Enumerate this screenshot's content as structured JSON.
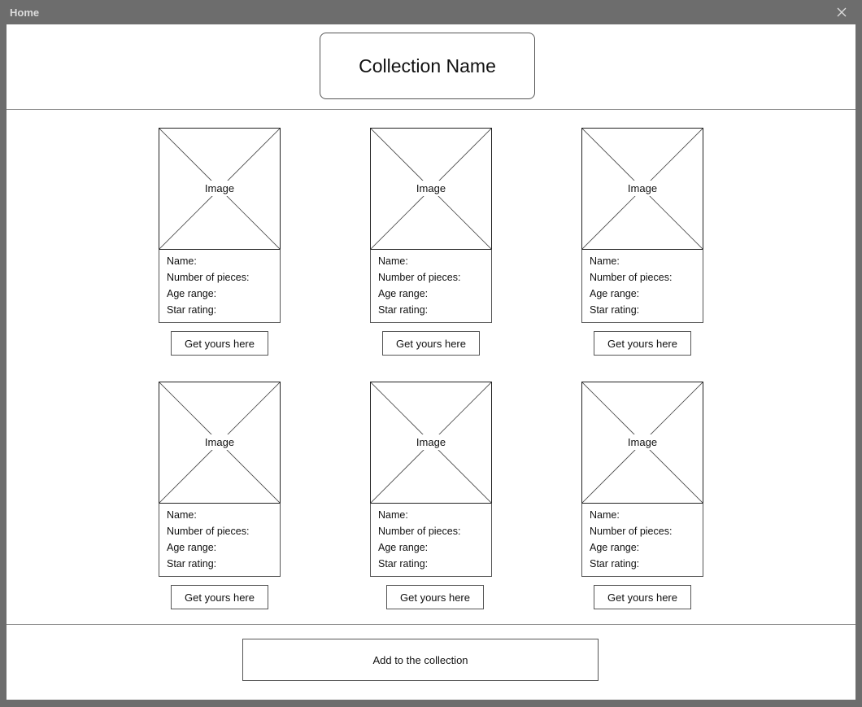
{
  "window": {
    "title": "Home"
  },
  "header": {
    "collection_name": "Collection Name"
  },
  "cards": [
    {
      "image_label": "Image",
      "name_label": "Name:",
      "pieces_label": "Number of pieces:",
      "age_label": "Age range:",
      "rating_label": "Star rating:",
      "button_label": "Get yours here"
    },
    {
      "image_label": "Image",
      "name_label": "Name:",
      "pieces_label": "Number of pieces:",
      "age_label": "Age range:",
      "rating_label": "Star rating:",
      "button_label": "Get yours here"
    },
    {
      "image_label": "Image",
      "name_label": "Name:",
      "pieces_label": "Number of pieces:",
      "age_label": "Age range:",
      "rating_label": "Star rating:",
      "button_label": "Get yours here"
    },
    {
      "image_label": "Image",
      "name_label": "Name:",
      "pieces_label": "Number of pieces:",
      "age_label": "Age range:",
      "rating_label": "Star rating:",
      "button_label": "Get yours here"
    },
    {
      "image_label": "Image",
      "name_label": "Name:",
      "pieces_label": "Number of pieces:",
      "age_label": "Age range:",
      "rating_label": "Star rating:",
      "button_label": "Get yours here"
    },
    {
      "image_label": "Image",
      "name_label": "Name:",
      "pieces_label": "Number of pieces:",
      "age_label": "Age range:",
      "rating_label": "Star rating:",
      "button_label": "Get yours here"
    }
  ],
  "footer": {
    "add_button_label": "Add to the collection"
  },
  "icons": {
    "close": "close-icon",
    "image_placeholder": "image-placeholder-icon"
  },
  "colors": {
    "window_frame": "#6d6d6d",
    "surface": "#ffffff",
    "border": "#555555",
    "text": "#111111"
  }
}
